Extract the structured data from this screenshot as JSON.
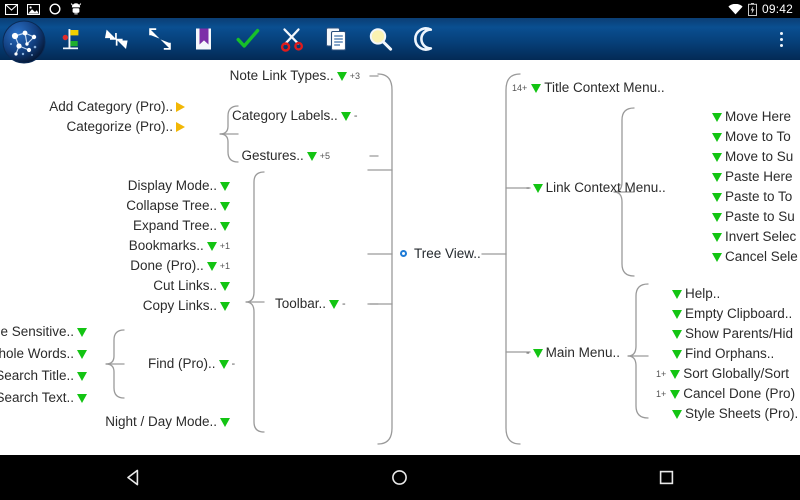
{
  "statusbar": {
    "time": "09:42",
    "icons": [
      "mail-icon",
      "image-icon",
      "circle-icon",
      "android-icon",
      "wifi-icon",
      "battery-icon"
    ]
  },
  "toolbar": {
    "logo": "app-logo-icon",
    "buttons": [
      {
        "name": "tree-markers-icon",
        "label": "Tree Markers"
      },
      {
        "name": "collapse-tree-icon",
        "label": "Collapse Tree"
      },
      {
        "name": "expand-tree-icon",
        "label": "Expand Tree"
      },
      {
        "name": "bookmark-icon",
        "label": "Bookmarks"
      },
      {
        "name": "done-check-icon",
        "label": "Done"
      },
      {
        "name": "cut-links-icon",
        "label": "Cut Links"
      },
      {
        "name": "copy-links-icon",
        "label": "Copy Links"
      },
      {
        "name": "search-icon",
        "label": "Find"
      },
      {
        "name": "night-mode-icon",
        "label": "Night / Day Mode"
      }
    ],
    "overflow_label": "More options"
  },
  "mindmap": {
    "root": {
      "label": "Tree View..",
      "marker": "root-dot"
    },
    "nodes": [
      {
        "id": "note-link-types",
        "label": "Note Link Types..",
        "tri": "green",
        "suffix": "+3",
        "prefix": ""
      },
      {
        "id": "add-category-pro",
        "label": "Add Category (Pro)..",
        "tri": "yellow",
        "suffix": "",
        "prefix": ""
      },
      {
        "id": "categorize-pro",
        "label": "Categorize (Pro)..",
        "tri": "yellow",
        "suffix": "",
        "prefix": ""
      },
      {
        "id": "category-labels",
        "label": "Category Labels..",
        "tri": "green",
        "suffix": "-",
        "prefix": ""
      },
      {
        "id": "gestures",
        "label": "Gestures..",
        "tri": "green",
        "suffix": "+5",
        "prefix": ""
      },
      {
        "id": "display-mode",
        "label": "Display Mode..",
        "tri": "green",
        "suffix": "",
        "prefix": ""
      },
      {
        "id": "collapse-tree",
        "label": "Collapse Tree..",
        "tri": "green",
        "suffix": "",
        "prefix": ""
      },
      {
        "id": "expand-tree",
        "label": "Expand Tree..",
        "tri": "green",
        "suffix": "",
        "prefix": ""
      },
      {
        "id": "bookmarks",
        "label": "Bookmarks..",
        "tri": "green",
        "suffix": "+1",
        "prefix": ""
      },
      {
        "id": "done-pro",
        "label": "Done (Pro)..",
        "tri": "green",
        "suffix": "+1",
        "prefix": ""
      },
      {
        "id": "cut-links",
        "label": "Cut Links..",
        "tri": "green",
        "suffix": "",
        "prefix": ""
      },
      {
        "id": "copy-links",
        "label": "Copy Links..",
        "tri": "green",
        "suffix": "",
        "prefix": ""
      },
      {
        "id": "toolbar-node",
        "label": "Toolbar..",
        "tri": "green",
        "suffix": "-",
        "prefix": ""
      },
      {
        "id": "case-sensitive",
        "label": "ase Sensitive..",
        "tri": "green",
        "suffix": "",
        "prefix": ""
      },
      {
        "id": "whole-words",
        "label": "Whole Words..",
        "tri": "green",
        "suffix": "",
        "prefix": ""
      },
      {
        "id": "search-title",
        "label": "Search Title..",
        "tri": "green",
        "suffix": "",
        "prefix": ""
      },
      {
        "id": "search-text",
        "label": "Search Text..",
        "tri": "green",
        "suffix": "",
        "prefix": ""
      },
      {
        "id": "find-pro",
        "label": "Find (Pro)..",
        "tri": "green",
        "suffix": "-",
        "prefix": ""
      },
      {
        "id": "night-day-mode",
        "label": "Night / Day Mode..",
        "tri": "green",
        "suffix": "",
        "prefix": ""
      },
      {
        "id": "title-context-menu",
        "label": "Title Context Menu..",
        "tri": "green",
        "suffix": "",
        "prefix": "14+"
      },
      {
        "id": "link-context-menu",
        "label": "Link Context Menu..",
        "tri": "green",
        "suffix": "",
        "prefix": "-"
      },
      {
        "id": "move-here",
        "label": "Move Here",
        "tri": "green",
        "suffix": "",
        "prefix": ""
      },
      {
        "id": "move-to-top",
        "label": "Move to To",
        "tri": "green",
        "suffix": "",
        "prefix": ""
      },
      {
        "id": "move-to-sub",
        "label": "Move to Su",
        "tri": "green",
        "suffix": "",
        "prefix": ""
      },
      {
        "id": "paste-here",
        "label": "Paste Here",
        "tri": "green",
        "suffix": "",
        "prefix": ""
      },
      {
        "id": "paste-to-top",
        "label": "Paste to To",
        "tri": "green",
        "suffix": "",
        "prefix": ""
      },
      {
        "id": "paste-to-sub",
        "label": "Paste to Su",
        "tri": "green",
        "suffix": "",
        "prefix": ""
      },
      {
        "id": "invert-selection",
        "label": "Invert Selec",
        "tri": "green",
        "suffix": "",
        "prefix": ""
      },
      {
        "id": "cancel-selection",
        "label": "Cancel Sele",
        "tri": "green",
        "suffix": "",
        "prefix": ""
      },
      {
        "id": "main-menu",
        "label": "Main Menu..",
        "tri": "green",
        "suffix": "",
        "prefix": "-"
      },
      {
        "id": "help",
        "label": "Help..",
        "tri": "green",
        "suffix": "",
        "prefix": ""
      },
      {
        "id": "empty-clipboard",
        "label": "Empty Clipboard..",
        "tri": "green",
        "suffix": "",
        "prefix": ""
      },
      {
        "id": "show-parents",
        "label": "Show Parents/Hid",
        "tri": "green",
        "suffix": "",
        "prefix": ""
      },
      {
        "id": "find-orphans",
        "label": "Find Orphans..",
        "tri": "green",
        "suffix": "",
        "prefix": ""
      },
      {
        "id": "sort-globally",
        "label": "Sort Globally/Sort",
        "tri": "green",
        "suffix": "",
        "prefix": "1+"
      },
      {
        "id": "cancel-done-pro",
        "label": "Cancel Done (Pro)",
        "tri": "green",
        "suffix": "",
        "prefix": "1+"
      },
      {
        "id": "style-sheets-pro",
        "label": "Style Sheets (Pro).",
        "tri": "green",
        "suffix": "",
        "prefix": ""
      }
    ]
  },
  "navbar": {
    "back_label": "Back",
    "home_label": "Home",
    "recents_label": "Recent apps"
  },
  "colors": {
    "toolbar_blue": "#0a4f91",
    "green_marker": "#13c413",
    "yellow_marker": "#f2b705",
    "root_accent": "#1f7bd6"
  }
}
